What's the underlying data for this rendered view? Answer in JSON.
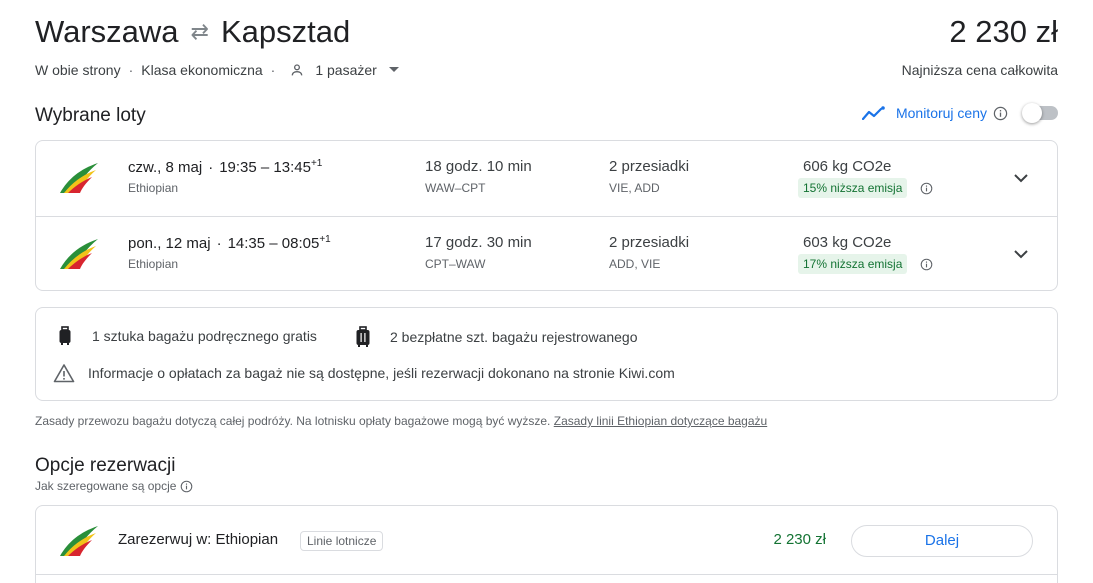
{
  "header": {
    "origin": "Warszawa",
    "destination": "Kapsztad",
    "price": "2 230 zł",
    "price_caption": "Najniższa cena całkowita",
    "trip_type": "W obie strony",
    "cabin_class": "Klasa ekonomiczna",
    "passengers": "1 pasażer"
  },
  "selected": {
    "title": "Wybrane loty",
    "monitor_label": "Monitoruj ceny"
  },
  "flights": [
    {
      "date": "czw., 8 maj",
      "times": "19:35 – 13:45",
      "day_offset": "+1",
      "airline": "Ethiopian",
      "duration": "18 godz. 10 min",
      "route": "WAW–CPT",
      "stops": "2 przesiadki",
      "stop_codes": "VIE, ADD",
      "co2": "606 kg CO2e",
      "emission_badge": "15% niższa emisja"
    },
    {
      "date": "pon., 12 maj",
      "times": "14:35 – 08:05",
      "day_offset": "+1",
      "airline": "Ethiopian",
      "duration": "17 godz. 30 min",
      "route": "CPT–WAW",
      "stops": "2 przesiadki",
      "stop_codes": "ADD, VIE",
      "co2": "603 kg CO2e",
      "emission_badge": "17% niższa emisja"
    }
  ],
  "baggage": {
    "carry_on": "1 sztuka bagażu podręcznego gratis",
    "checked": "2 bezpłatne szt. bagażu rejestrowanego",
    "warning": "Informacje o opłatach za bagaż nie są dostępne, jeśli rezerwacji dokonano na stronie Kiwi.com"
  },
  "policy": {
    "text": "Zasady przewozu bagażu dotyczą całej podróży. Na lotnisku opłaty bagażowe mogą być wyższe.",
    "link": "Zasady linii Ethiopian dotyczące bagażu"
  },
  "booking": {
    "title": "Opcje rezerwacji",
    "subtitle": "Jak szeregowane są opcje",
    "options": [
      {
        "label": "Zarezerwuj w: Ethiopian",
        "tag": "Linie lotnicze",
        "price": "2 230 zł",
        "button": "Dalej"
      }
    ]
  },
  "colors": {
    "accent": "#1a73e8",
    "green": "#137333",
    "badge_bg": "#e6f4ea",
    "border": "#dadce0"
  }
}
